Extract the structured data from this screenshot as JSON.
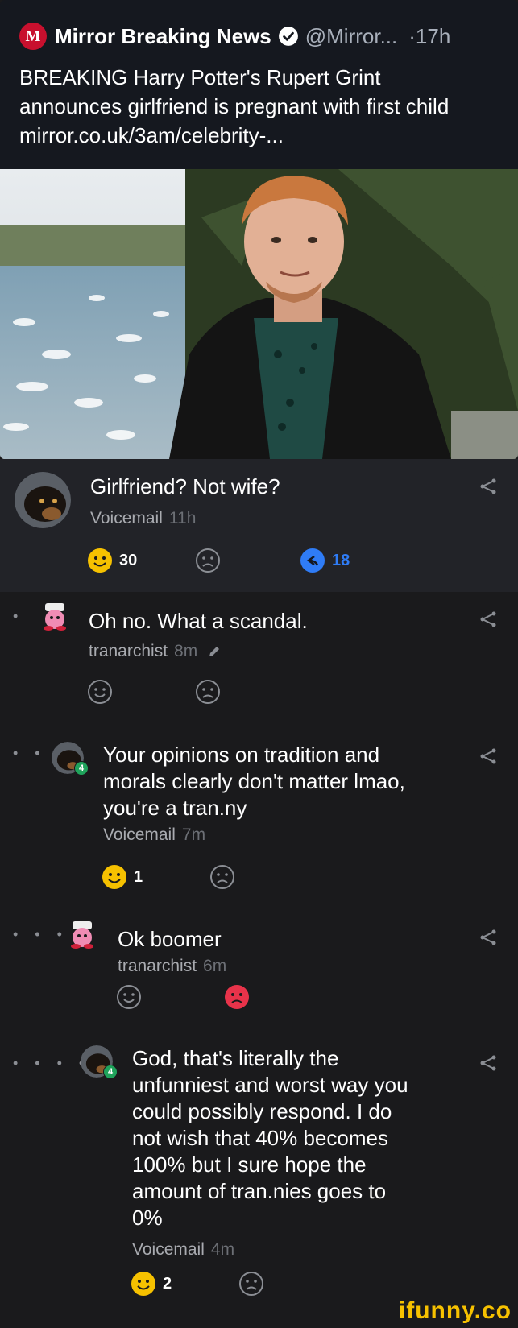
{
  "tweet": {
    "logo": "M",
    "account": "Mirror Breaking News",
    "handle": "@Mirror...",
    "time": "·17h",
    "text": "BREAKING Harry Potter's Rupert Grint announces girlfriend is pregnant with first child mirror.co.uk/3am/celebrity-...",
    "image": "photo-man-red-hair-black-suit-harbor-background"
  },
  "comments": [
    {
      "text": "Girlfriend? Not wife?",
      "user": "Voicemail",
      "time": "11h",
      "smile_count": "30",
      "reply_count": "18"
    },
    {
      "depth": "•",
      "text": "Oh no. What a scandal.",
      "user": "tranarchist",
      "time": "8m"
    },
    {
      "depth": "• •",
      "text_lines": [
        "Your opinions on tradition and",
        "morals clearly don't matter lmao,",
        "you're a tran.ny"
      ],
      "user": "Voicemail",
      "time": "7m",
      "badge": "4",
      "smile_count": "1"
    },
    {
      "depth": "• • •",
      "text": "Ok boomer",
      "user": "tranarchist",
      "time": "6m"
    },
    {
      "depth": "• • • •",
      "text_lines": [
        "God, that's literally the",
        "unfunniest and worst way you",
        "could possibly respond. I do",
        "not wish that 40% becomes",
        "100% but I sure hope the",
        "amount of tran.nies goes to",
        "0%"
      ],
      "user": "Voicemail",
      "time": "4m",
      "badge": "4",
      "smile_count": "2"
    }
  ],
  "watermark": "ifunny.co",
  "colors": {
    "smile": "#f6c100",
    "frown_active": "#e8334a",
    "reply": "#2f7cf6",
    "badge": "#1fa35b"
  }
}
